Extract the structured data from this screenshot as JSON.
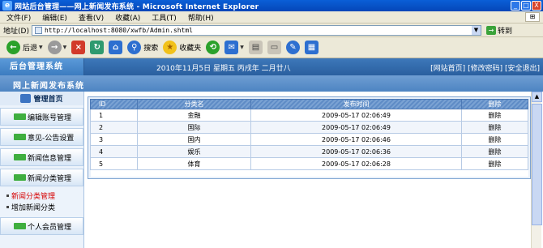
{
  "window": {
    "title": "网站后台管理——网上新闻发布系统 - Microsoft Internet Explorer",
    "controls": [
      "_",
      "□",
      "X"
    ]
  },
  "menu": [
    "文件(F)",
    "编辑(E)",
    "查看(V)",
    "收藏(A)",
    "工具(T)",
    "帮助(H)"
  ],
  "address": {
    "label": "地址(D)",
    "url": "http://localhost:8080/xwfb/Admin.shtml",
    "go_label": "转到"
  },
  "toolbar": {
    "back": "后退",
    "search": "搜索",
    "favorites": "收藏夹"
  },
  "header": {
    "logo": "后台管理系统",
    "date_line": "2010年11月5日  星期五  丙戌年 二月廿八",
    "links": [
      "[网站首页]",
      "[修改密码]",
      "[安全退出]"
    ],
    "system_title": "网上新闻发布系统"
  },
  "sidebar": {
    "home": "管理首页",
    "items": [
      {
        "label": "编辑账号管理"
      },
      {
        "label": "意见-公告设置"
      },
      {
        "label": "新闻信息管理"
      },
      {
        "label": "新闻分类管理"
      }
    ],
    "subitems": [
      {
        "label": "新闻分类管理",
        "active": true
      },
      {
        "label": "增加新闻分类",
        "active": false
      }
    ],
    "last_item": "个人会员管理"
  },
  "table": {
    "headers": [
      "ID",
      "分类名",
      "发布时间",
      "删除"
    ],
    "rows": [
      {
        "id": "1",
        "name": "金融",
        "time": "2009-05-17 02:06:49",
        "action": "删除"
      },
      {
        "id": "2",
        "name": "国际",
        "time": "2009-05-17 02:06:49",
        "action": "删除"
      },
      {
        "id": "3",
        "name": "国内",
        "time": "2009-05-17 02:06:46",
        "action": "删除"
      },
      {
        "id": "4",
        "name": "娱乐",
        "time": "2009-05-17 02:06:36",
        "action": "删除"
      },
      {
        "id": "5",
        "name": "体育",
        "time": "2009-05-17 02:06:28",
        "action": "删除"
      }
    ]
  }
}
